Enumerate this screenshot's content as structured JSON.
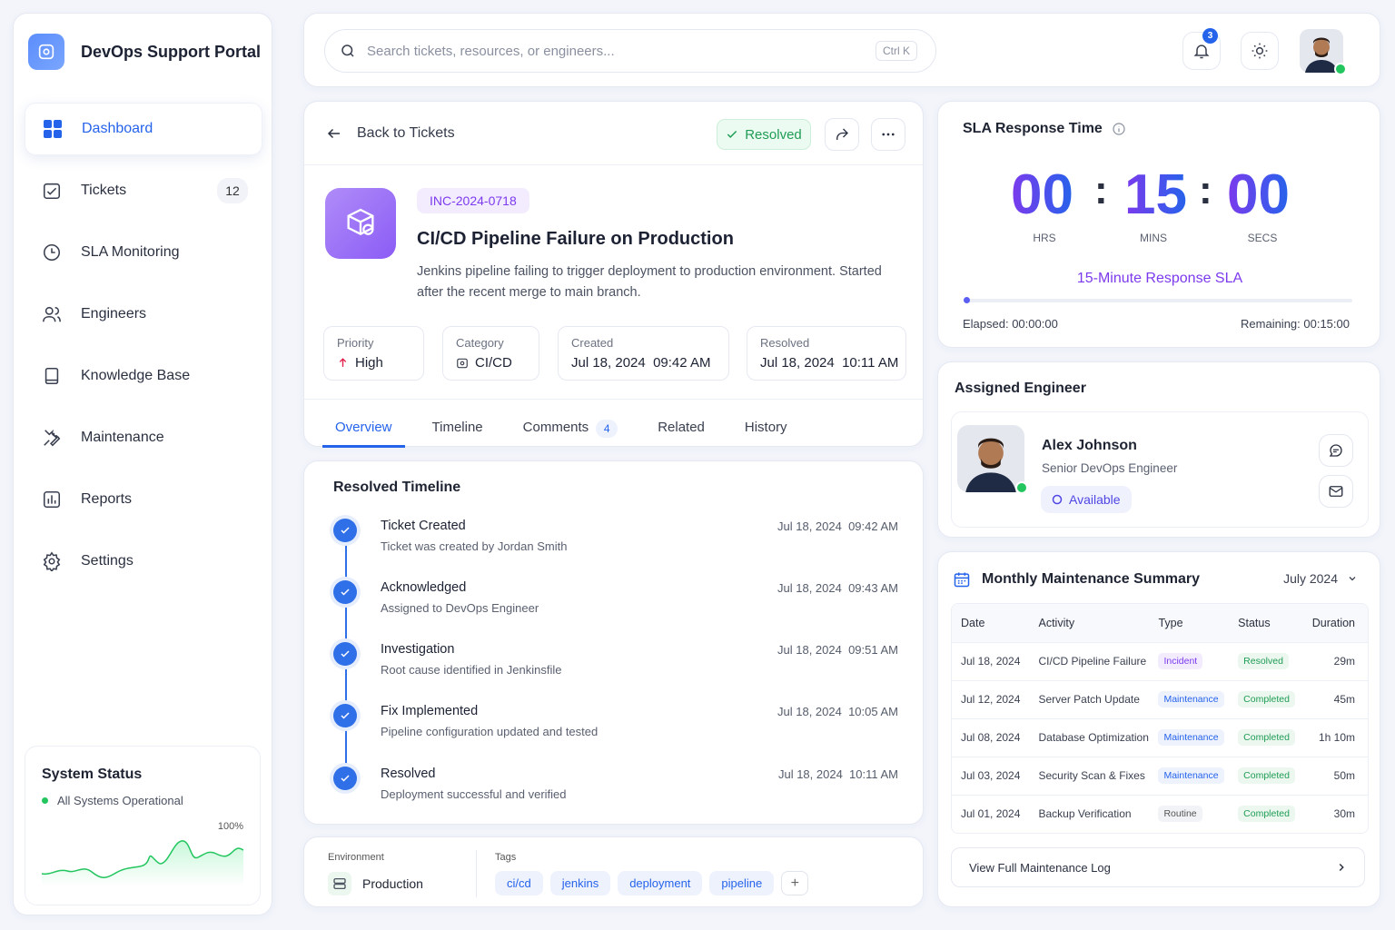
{
  "app": {
    "title": "DevOps Support Portal"
  },
  "sidebar": {
    "items": [
      {
        "label": "Dashboard",
        "icon": "grid-icon",
        "active": true
      },
      {
        "label": "Tickets",
        "icon": "ticket-icon",
        "badge": "12"
      },
      {
        "label": "SLA Monitoring",
        "icon": "clock-icon"
      },
      {
        "label": "Engineers",
        "icon": "users-icon"
      },
      {
        "label": "Knowledge Base",
        "icon": "book-icon"
      },
      {
        "label": "Maintenance",
        "icon": "wrench-icon"
      },
      {
        "label": "Reports",
        "icon": "chart-icon"
      },
      {
        "label": "Settings",
        "icon": "gear-icon"
      }
    ],
    "system_status": {
      "title": "System Status",
      "status": "All Systems Operational",
      "percent": "100%"
    }
  },
  "topbar": {
    "search_placeholder": "Search tickets, resources, or engineers...",
    "shortcut": "Ctrl K",
    "notifications": "3"
  },
  "ticket": {
    "back_label": "Back to Tickets",
    "status": "Resolved",
    "id": "INC-2024-0718",
    "title": "CI/CD Pipeline Failure on Production",
    "description": "Jenkins pipeline failing to trigger deployment to production environment. Started after the recent merge to main branch.",
    "meta": {
      "priority": {
        "label": "Priority",
        "value": "High"
      },
      "category": {
        "label": "Category",
        "value": "CI/CD"
      },
      "created": {
        "label": "Created",
        "value": "Jul 18, 2024  09:42 AM"
      },
      "resolved": {
        "label": "Resolved",
        "value": "Jul 18, 2024  10:11 AM"
      }
    },
    "tabs": [
      {
        "label": "Overview",
        "active": true
      },
      {
        "label": "Timeline"
      },
      {
        "label": "Comments",
        "count": "4"
      },
      {
        "label": "Related"
      },
      {
        "label": "History"
      }
    ]
  },
  "timeline": {
    "title": "Resolved Timeline",
    "items": [
      {
        "title": "Ticket Created",
        "desc": "Ticket was created by Jordan Smith",
        "time": "Jul 18, 2024  09:42 AM"
      },
      {
        "title": "Acknowledged",
        "desc": "Assigned to DevOps Engineer",
        "time": "Jul 18, 2024  09:43 AM"
      },
      {
        "title": "Investigation",
        "desc": "Root cause identified in Jenkinsfile",
        "time": "Jul 18, 2024  09:51 AM"
      },
      {
        "title": "Fix Implemented",
        "desc": "Pipeline configuration updated and tested",
        "time": "Jul 18, 2024  10:05 AM"
      },
      {
        "title": "Resolved",
        "desc": "Deployment successful and verified",
        "time": "Jul 18, 2024  10:11 AM"
      }
    ]
  },
  "tags": {
    "env_label": "Environment",
    "env_value": "Production",
    "tags_label": "Tags",
    "items": [
      "ci/cd",
      "jenkins",
      "deployment",
      "pipeline"
    ],
    "add": "+"
  },
  "sla": {
    "title": "SLA Response Time",
    "hrs": "00",
    "mins": "15",
    "secs": "00",
    "hrs_label": "HRS",
    "mins_label": "MINS",
    "secs_label": "SECS",
    "name": "15-Minute Response SLA",
    "elapsed": "Elapsed: 00:00:00",
    "remaining": "Remaining: 00:15:00",
    "progress": 0
  },
  "engineer": {
    "title": "Assigned Engineer",
    "name": "Alex Johnson",
    "role": "Senior DevOps Engineer",
    "status": "Available"
  },
  "maintenance": {
    "title": "Monthly Maintenance Summary",
    "month": "July 2024",
    "columns": [
      "Date",
      "Activity",
      "Type",
      "Status",
      "Duration"
    ],
    "rows": [
      {
        "date": "Jul 18, 2024",
        "activity": "CI/CD Pipeline Failure",
        "type": "Incident",
        "status": "Resolved",
        "duration": "29m"
      },
      {
        "date": "Jul 12, 2024",
        "activity": "Server Patch Update",
        "type": "Maintenance",
        "status": "Completed",
        "duration": "45m"
      },
      {
        "date": "Jul 08, 2024",
        "activity": "Database Optimization",
        "type": "Maintenance",
        "status": "Completed",
        "duration": "1h 10m"
      },
      {
        "date": "Jul 03, 2024",
        "activity": "Security Scan & Fixes",
        "type": "Maintenance",
        "status": "Completed",
        "duration": "50m"
      },
      {
        "date": "Jul 01, 2024",
        "activity": "Backup Verification",
        "type": "Routine",
        "status": "Completed",
        "duration": "30m"
      }
    ],
    "link": "View Full Maintenance Log"
  },
  "colors": {
    "accent": "#2563eb",
    "purple": "#7c3aed",
    "success": "#22c55e"
  }
}
